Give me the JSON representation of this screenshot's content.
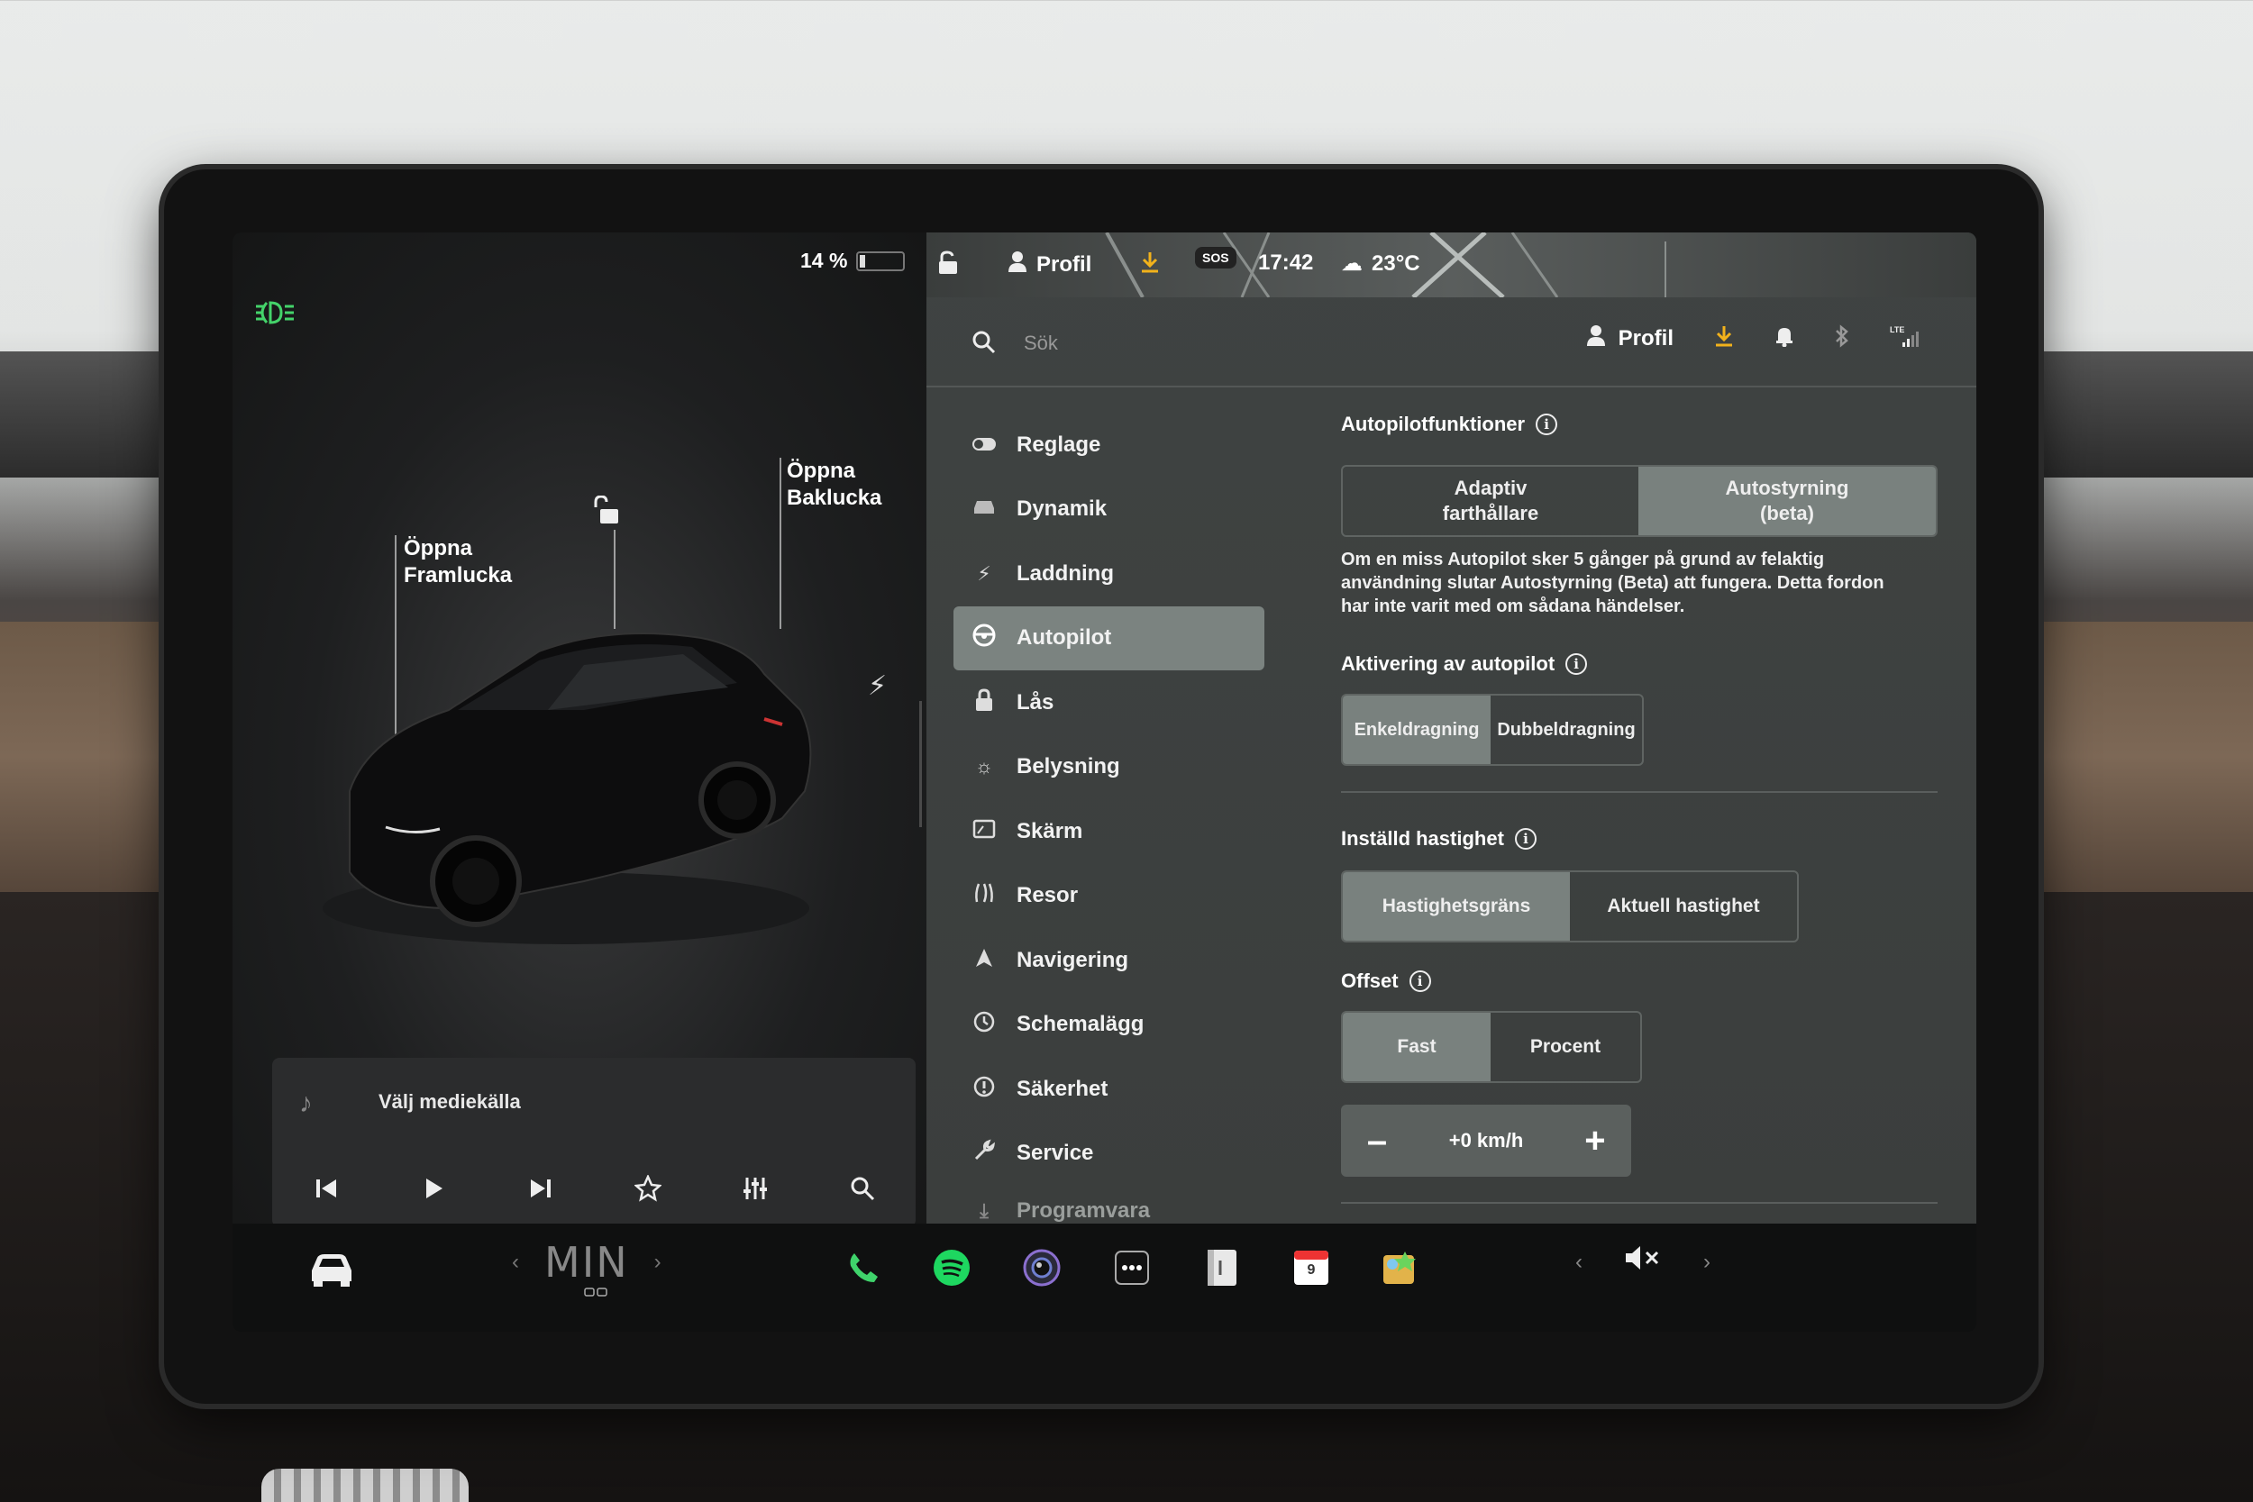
{
  "status": {
    "battery_pct": "14 %",
    "battery_level": 0.14,
    "profile": "Profil",
    "sos": "SOS",
    "time": "17:42",
    "temperature": "23°C"
  },
  "car": {
    "frunk_label_1": "Öppna",
    "frunk_label_2": "Framlucka",
    "trunk_label_1": "Öppna",
    "trunk_label_2": "Baklucka"
  },
  "media": {
    "title": "Välj mediekälla"
  },
  "search": {
    "placeholder": "Sök",
    "profile": "Profil"
  },
  "nav": {
    "items": [
      {
        "label": "Reglage",
        "icon": "toggle-icon"
      },
      {
        "label": "Dynamik",
        "icon": "car-front-icon"
      },
      {
        "label": "Laddning",
        "icon": "bolt-icon"
      },
      {
        "label": "Autopilot",
        "icon": "steering-wheel-icon"
      },
      {
        "label": "Lås",
        "icon": "lock-icon"
      },
      {
        "label": "Belysning",
        "icon": "sun-icon"
      },
      {
        "label": "Skärm",
        "icon": "display-icon"
      },
      {
        "label": "Resor",
        "icon": "trips-icon"
      },
      {
        "label": "Navigering",
        "icon": "navigation-icon"
      },
      {
        "label": "Schemalägg",
        "icon": "schedule-icon"
      },
      {
        "label": "Säkerhet",
        "icon": "safety-icon"
      },
      {
        "label": "Service",
        "icon": "wrench-icon"
      },
      {
        "label": "Programvara",
        "icon": "download-icon"
      }
    ]
  },
  "autopilot": {
    "features_title": "Autopilotfunktioner",
    "features_opt1_l1": "Adaptiv",
    "features_opt1_l2": "farthållare",
    "features_opt2_l1": "Autostyrning",
    "features_opt2_l2": "(beta)",
    "desc_l1": "Om en miss Autopilot sker 5 gånger på grund av felaktig",
    "desc_l2": "användning slutar Autostyrning (Beta) att fungera. Detta fordon",
    "desc_l3": "har inte varit med om sådana händelser.",
    "activation_title": "Aktivering av autopilot",
    "activation_opt1": "Enkeldragning",
    "activation_opt2": "Dubbeldragning",
    "speed_title": "Inställd hastighet",
    "speed_opt1": "Hastighetsgräns",
    "speed_opt2": "Aktuell hastighet",
    "offset_title": "Offset",
    "offset_opt1": "Fast",
    "offset_opt2": "Procent",
    "offset_minus": "–",
    "offset_value": "+0 km/h",
    "offset_plus": "+"
  },
  "dock": {
    "climate_temp": "MIN",
    "calendar_day": "9",
    "apps": [
      "phone-icon",
      "spotify-icon",
      "camera-icon",
      "more-icon",
      "notes-icon",
      "calendar-icon",
      "toybox-icon"
    ]
  },
  "colors": {
    "accent_green": "#44d36a",
    "download_yellow": "#f2b21b",
    "selected_segment": "#79817e"
  }
}
